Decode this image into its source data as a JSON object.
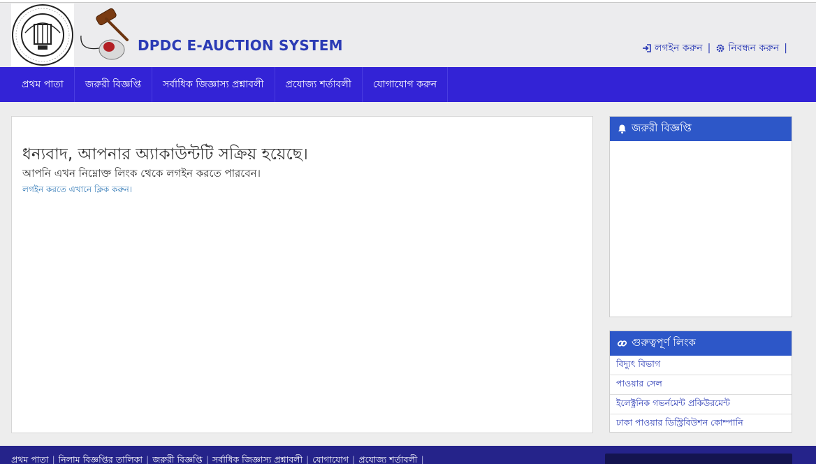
{
  "header": {
    "brand": "DPDC E-AUCTION SYSTEM",
    "logo_icon": "dpdc-logo-icon",
    "login_label": "লগইন করুন",
    "register_label": "নিবন্ধন করুন",
    "separator": "|"
  },
  "nav": {
    "items": [
      {
        "label": "প্রথম পাতা"
      },
      {
        "label": "জরুরী বিজ্ঞপ্তি"
      },
      {
        "label": "সর্বাধিক জিজ্ঞাস্য প্রশ্নাবলী"
      },
      {
        "label": "প্রযোজ্য শর্তাবলী"
      },
      {
        "label": "যোগাযোগ করুন"
      }
    ]
  },
  "main": {
    "title": "ধন্যবাদ, আপনার অ্যাকাউন্টটি সক্রিয় হয়েছে।",
    "subtitle": "আপনি এখন নিম্নোক্ত লিংক থেকে লগইন করতে পারবেন।",
    "login_link": "লগইন করতে এখানে ক্লিক করুন।"
  },
  "sidebar": {
    "notice_title": "জরুরী বিজ্ঞপ্তি",
    "links_title": "গুরুত্বপূর্ণ লিংক",
    "links": [
      {
        "label": "বিদ্যুৎ বিভাগ"
      },
      {
        "label": "পাওয়ার সেল"
      },
      {
        "label": "ইলেক্ট্রনিক গভর্নমেন্ট প্রকিউরমেন্ট"
      },
      {
        "label": "ঢাকা পাওয়ার ডিস্ট্রিবিউশন কোম্পানি"
      }
    ]
  },
  "footer": {
    "links": [
      {
        "label": "প্রথম পাতা"
      },
      {
        "label": "নিলাম বিজ্ঞপ্তির তালিকা"
      },
      {
        "label": "জরুরী বিজ্ঞপ্তি"
      },
      {
        "label": "সর্বাধিক জিজ্ঞাস্য প্রশ্নাবলী"
      },
      {
        "label": "যোগাযোগ"
      },
      {
        "label": "প্রযোজ্য শর্তাবলী"
      }
    ],
    "separator": "|"
  },
  "colors": {
    "nav_bg": "#3323d6",
    "brand_text": "#2b3bb5",
    "panel_head": "#2d57c8",
    "footer_bg": "#25238a",
    "link": "#337ab7"
  }
}
